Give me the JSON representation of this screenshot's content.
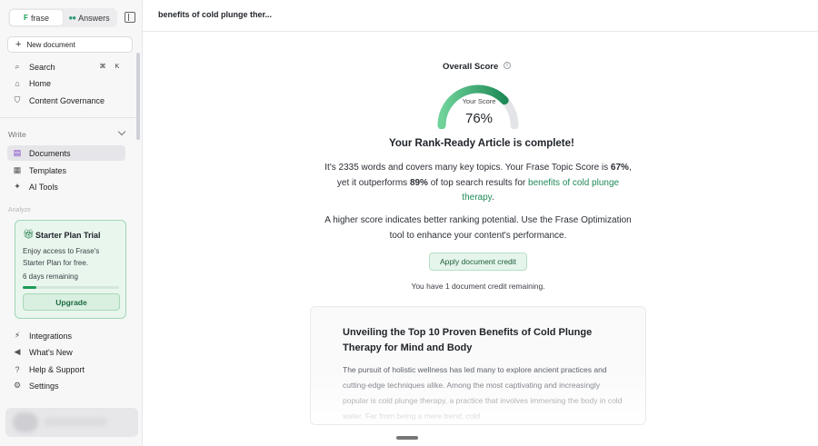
{
  "sidebar": {
    "switcher": {
      "frase_label": "frase",
      "answers_label": "Answers"
    },
    "new_document": "New document",
    "search_label": "Search",
    "shortcut": {
      "mod": "⌘",
      "key": "K"
    },
    "nav_top": [
      {
        "label": "Home"
      },
      {
        "label": "Content Governance"
      }
    ],
    "write_section": "Write",
    "write_items": [
      {
        "label": "Documents"
      },
      {
        "label": "Templates"
      },
      {
        "label": "AI Tools"
      }
    ],
    "analyze_section": "Analyze",
    "trial": {
      "title": "Starter Plan Trial",
      "description": "Enjoy access to Frase's Starter Plan for free.",
      "days_remaining": "6 days remaining",
      "progress_fraction": 0.14,
      "upgrade": "Upgrade"
    },
    "nav_bottom": [
      {
        "label": "Integrations"
      },
      {
        "label": "What's New"
      },
      {
        "label": "Help & Support"
      },
      {
        "label": "Settings"
      }
    ]
  },
  "main": {
    "doc_title": "benefits of cold plunge ther...",
    "score": {
      "label": "Overall Score",
      "caption": "Your Score",
      "value_text": "76%",
      "value": 76
    },
    "complete_heading": "Your Rank-Ready Article is complete!",
    "summary": {
      "part1": "It's 2335 words and covers many key topics. Your Frase Topic Score is ",
      "topic_score": "67%",
      "part2": ", yet it outperforms ",
      "outperform": "89%",
      "part3": " of top search results for ",
      "keyword": "benefits of cold plunge therapy",
      "part4": "."
    },
    "tip": "A higher score indicates better ranking potential. Use the Frase Optimization tool to enhance your content's performance.",
    "apply_button": "Apply document credit",
    "credit_note": "You have 1 document credit remaining.",
    "preview": {
      "title": "Unveiling the Top 10 Proven Benefits of Cold Plunge Therapy for Mind and Body",
      "body": "The pursuit of holistic wellness has led many to explore ancient practices and cutting-edge techniques alike. Among the most captivating and increasingly popular is cold plunge therapy, a practice that involves immersing the body in cold water. Far from being a mere trend, cold"
    }
  },
  "colors": {
    "accent": "#1d9a59",
    "gauge_track": "#e3e4e7",
    "trial_bg": "#e9f6ee"
  }
}
